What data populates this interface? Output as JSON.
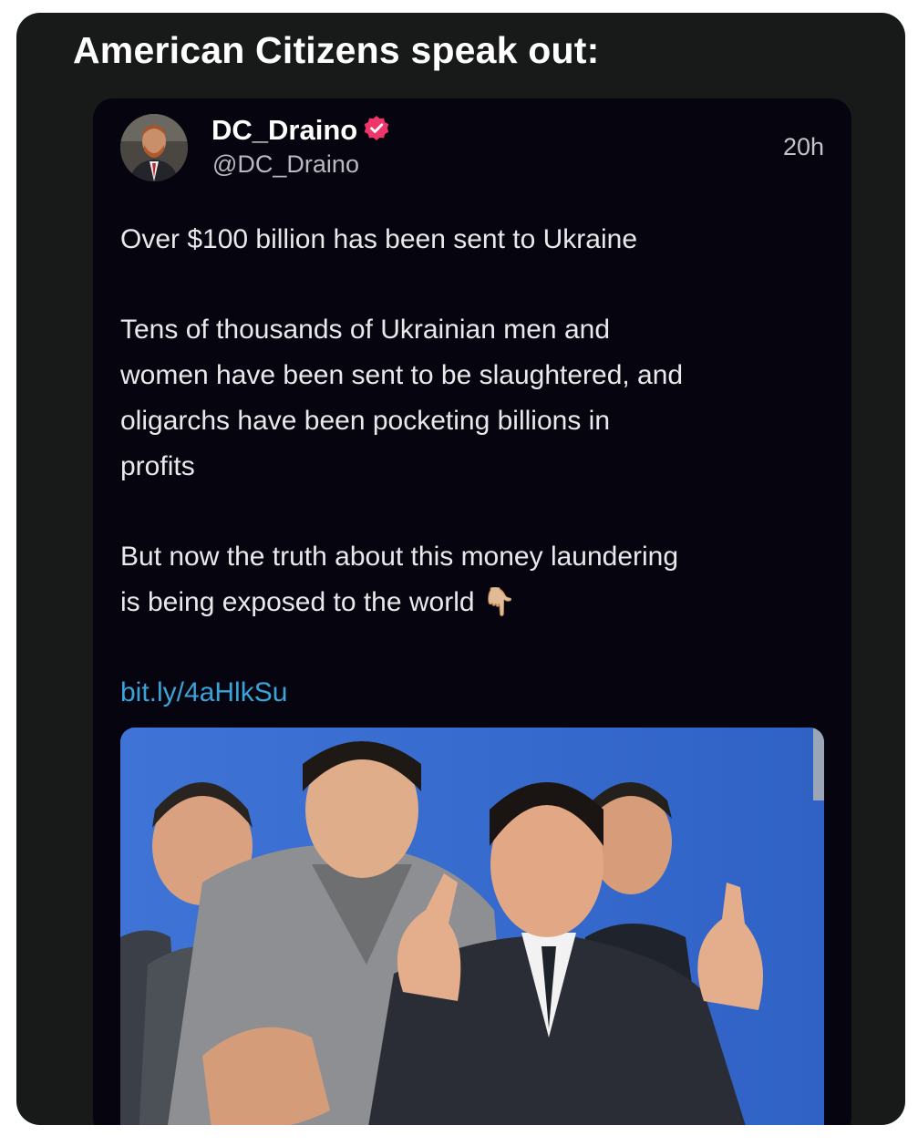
{
  "headline": "American Citizens speak out:",
  "tweet": {
    "author": {
      "display_name": "DC_Draino",
      "handle": "@DC_Draino",
      "verified": true,
      "verified_icon": "verified-badge-icon",
      "verified_color": "#f0356a"
    },
    "timestamp": "20h",
    "paragraphs": [
      "Over $100 billion has been sent to Ukraine",
      "Tens of thousands of Ukrainian men and\nwomen have been sent to be slaughtered, and\noligarchs have been pocketing billions in\nprofits",
      "But now the truth about this money laundering\nis being exposed to the world 👇🏼"
    ],
    "link": "bit.ly/4aHlkSu",
    "link_color": "#3aa3d8"
  },
  "colors": {
    "frame_background": "#181a1a",
    "card_background": "#06050f",
    "photo_background": "#3b6fd0"
  }
}
